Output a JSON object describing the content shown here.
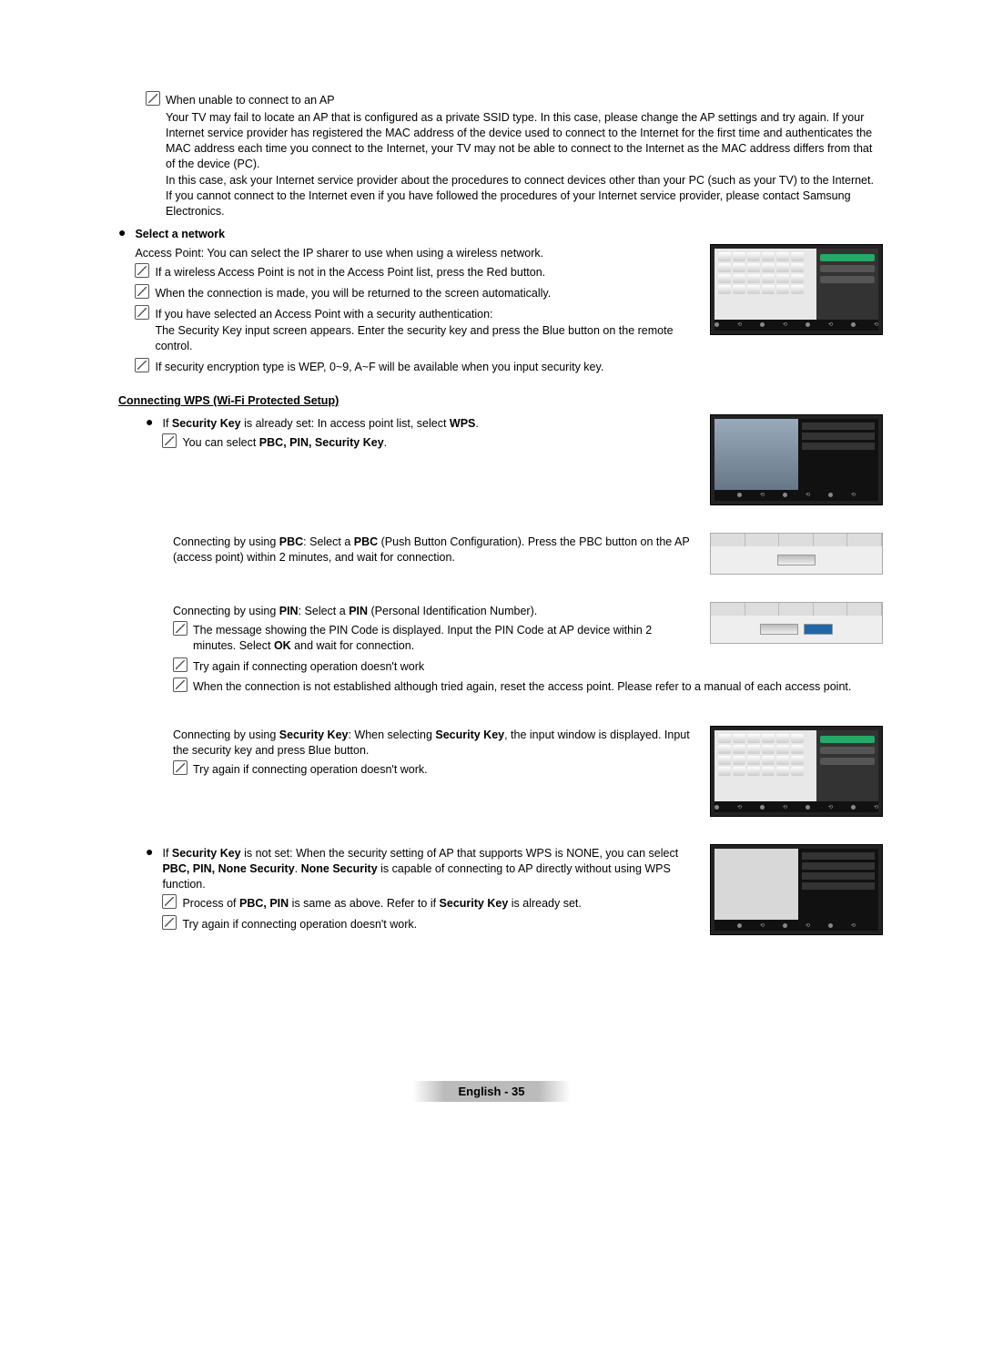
{
  "s1": {
    "title": "When unable to connect to an AP",
    "p1": "Your TV may fail to locate an AP that is configured as a private SSID type. In this case, please change the AP settings and try again. If your Internet service provider has registered the MAC address of the device used to connect to the Internet for the first time and authenticates the MAC address each time you connect to the Internet, your TV may not be able to connect to the Internet as the MAC address differs from that of the device (PC).",
    "p2": "In this case, ask your Internet service provider about the procedures to connect devices other than your PC (such as your TV) to the Internet. If you cannot connect to the Internet even if you have followed the procedures of your Internet service provider, please contact Samsung Electronics."
  },
  "s2": {
    "title": "Select a network",
    "p1": "Access Point: You can select the IP sharer to use when using a wireless network.",
    "n1": "If a wireless Access Point is not in the Access Point list, press the Red button.",
    "n2": "When the connection is made, you will be returned to the screen automatically.",
    "n3a": "If you have selected an Access Point with a security authentication:",
    "n3b": "The Security Key input screen appears. Enter the security key and press the Blue button on the remote control.",
    "n4": "If security encryption type is WEP, 0~9, A~F will be available when you input security key."
  },
  "wps": {
    "title": "Connecting WPS (Wi-Fi Protected Setup)",
    "b1_pre": "If ",
    "b1_bold1": "Security Key",
    "b1_mid": " is already set: In access point list, select ",
    "b1_bold2": "WPS",
    "b1_end": ".",
    "n1_pre": "You can select ",
    "n1_bold": "PBC, PIN, Security Key",
    "n1_end": "."
  },
  "pbc": {
    "pre": "Connecting by using ",
    "b1": "PBC",
    "mid1": ": Select a ",
    "b2": "PBC",
    "mid2": " (Push Button Configuration). Press the PBC button on the AP (access point) within 2 minutes, and wait for connection."
  },
  "pin": {
    "pre": "Connecting by using ",
    "b1": "PIN",
    "mid1": ": Select a ",
    "b2": "PIN",
    "mid2": " (Personal Identification Number).",
    "n1_a": "The message showing the PIN Code is displayed. Input the PIN Code at AP device within 2 minutes. Select ",
    "n1_b": "OK",
    "n1_c": " and wait for connection.",
    "n2": "Try again if connecting operation doesn't work",
    "n3": "When the connection is not established although tried again, reset the access point. Please refer to a manual of each access point."
  },
  "sk": {
    "pre": "Connecting by using ",
    "b1": "Security Key",
    "mid1": ": When selecting ",
    "b2": "Security Key",
    "mid2": ", the input window is displayed. Input the security key and press Blue button.",
    "n1": "Try again if connecting operation doesn't work."
  },
  "notset": {
    "pre": "If ",
    "b1": "Security Key",
    "mid1": " is not set: When the security setting of AP that supports WPS is NONE, you can select ",
    "b2": "PBC, PIN, None Security",
    "mid2": ". ",
    "b3": "None Security",
    "mid3": " is capable of connecting to AP directly without using WPS function.",
    "n1_a": "Process of ",
    "n1_b": "PBC, PIN",
    "n1_c": " is same as above. Refer to if ",
    "n1_d": "Security Key",
    "n1_e": " is already set.",
    "n2": "Try again if connecting operation doesn't work."
  },
  "footer": "English - 35"
}
